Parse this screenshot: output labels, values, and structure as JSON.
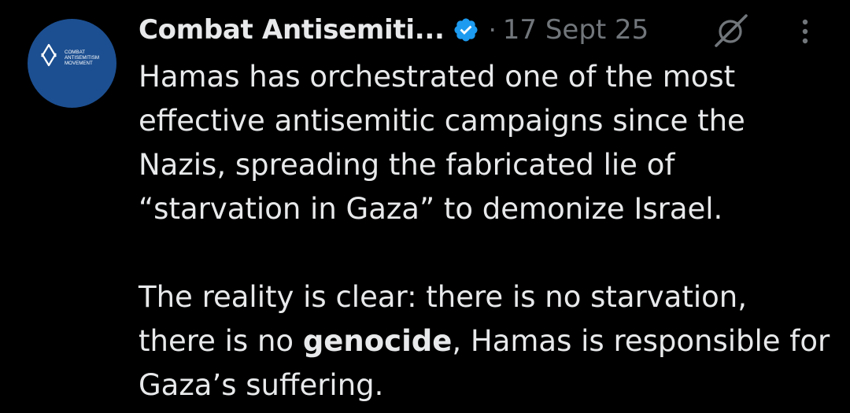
{
  "author": {
    "display_name": "Combat Antisemiti...",
    "verified": true,
    "avatar": {
      "background_color": "#1c4f91",
      "logo_icon": "star-of-david-icon",
      "logo_text_line1": "COMBAT",
      "logo_text_line2": "ANTISEMITISM",
      "logo_text_line3": "MOVEMENT"
    }
  },
  "meta": {
    "separator": "·",
    "timestamp": "17 Sept 25"
  },
  "icons": {
    "grok": "grok-icon",
    "more": "more-options-icon",
    "verified": "verified-badge-icon",
    "verified_color": "#1d9bf0"
  },
  "tweet": {
    "paragraph1": "Hamas has orchestrated one of the most effective antisemitic campaigns since the Nazis, spreading the fabricated lie of “starvation in Gaza” to demonize Israel.",
    "paragraph2_part1": "The reality is clear: there is no starvation, there is no ",
    "paragraph2_bold": "genocide",
    "paragraph2_part2": ", Hamas is responsible for Gaza’s suffering."
  },
  "colors": {
    "background": "#000000",
    "text": "#e7e9ea",
    "secondary_text": "#71767b"
  }
}
